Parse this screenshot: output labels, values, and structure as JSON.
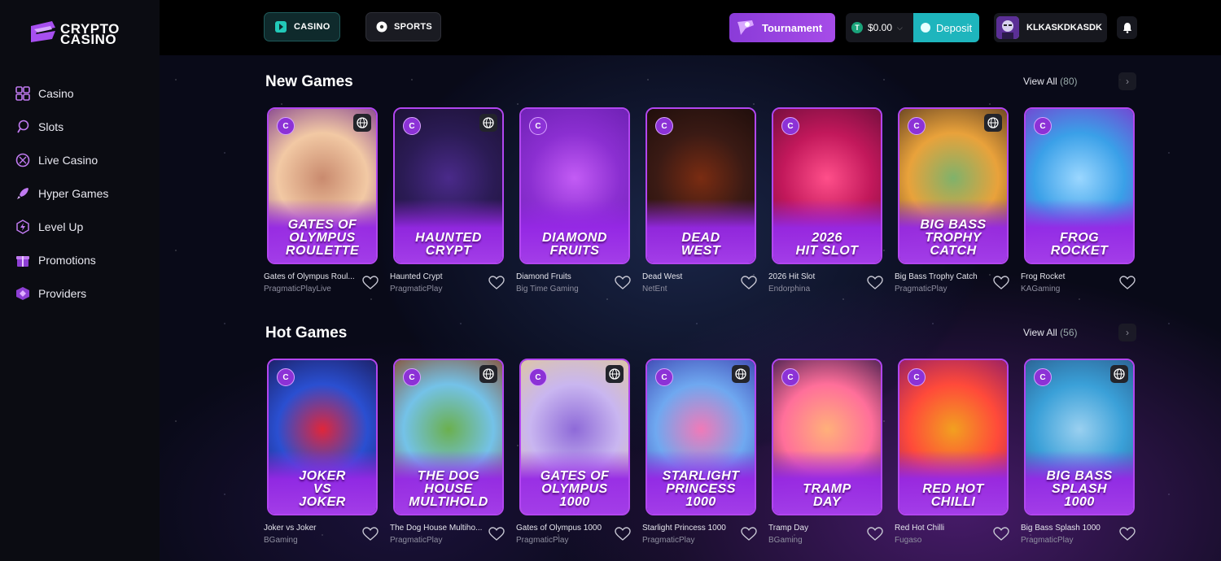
{
  "brand": {
    "line1": "CRYPTO",
    "line2": "CASINO"
  },
  "sidebar": {
    "items": [
      {
        "label": "Casino",
        "icon": "grid-icon"
      },
      {
        "label": "Slots",
        "icon": "slots-icon"
      },
      {
        "label": "Live Casino",
        "icon": "live-casino-icon"
      },
      {
        "label": "Hyper Games",
        "icon": "rocket-icon"
      },
      {
        "label": "Level Up",
        "icon": "level-up-icon"
      },
      {
        "label": "Promotions",
        "icon": "gift-icon"
      },
      {
        "label": "Providers",
        "icon": "providers-icon"
      }
    ]
  },
  "topbar": {
    "casino_label": "CASINO",
    "sports_label": "SPORTS",
    "tournament_label": "Tournament",
    "balance": "$0.00",
    "currency_symbol": "T",
    "deposit_label": "Deposit",
    "username": "KLKASKDKASDK"
  },
  "sections": [
    {
      "title": "New Games",
      "view_all": "View All",
      "count": "(80)",
      "games": [
        {
          "title_l1": "GATES OF",
          "title_l2": "OLYMPUS",
          "title_l3": "ROULETTE",
          "name": "Gates of Olympus Roul...",
          "provider": "PragmaticPlayLive",
          "live": true,
          "colors": [
            "#f2c9a4",
            "#c98a6e",
            "#7d3b8e"
          ]
        },
        {
          "title_l1": "",
          "title_l2": "HAUNTED",
          "title_l3": "CRYPT",
          "name": "Haunted Crypt",
          "provider": "PragmaticPlay",
          "live": true,
          "colors": [
            "#2b1b55",
            "#4a2a8a",
            "#1a1030"
          ]
        },
        {
          "title_l1": "",
          "title_l2": "DIAMOND",
          "title_l3": "FRUITS",
          "name": "Diamond Fruits",
          "provider": "Big Time Gaming",
          "live": false,
          "colors": [
            "#8b2fd1",
            "#c35cf5",
            "#6a1fb0"
          ]
        },
        {
          "title_l1": "",
          "title_l2": "DEAD",
          "title_l3": "WEST",
          "name": "Dead West",
          "provider": "NetEnt",
          "live": false,
          "colors": [
            "#3a1a14",
            "#7a2c12",
            "#1b0c0a"
          ]
        },
        {
          "title_l1": "",
          "title_l2": "2026",
          "title_l3": "HIT SLOT",
          "name": "2026 Hit Slot",
          "provider": "Endorphina",
          "live": false,
          "colors": [
            "#c2185b",
            "#ff4f8a",
            "#6a0d3a"
          ]
        },
        {
          "title_l1": "BIG BASS",
          "title_l2": "TROPHY",
          "title_l3": "CATCH",
          "name": "Big Bass Trophy Catch",
          "provider": "PragmaticPlay",
          "live": true,
          "colors": [
            "#e9a23b",
            "#7fb26b",
            "#5a3a20"
          ]
        },
        {
          "title_l1": "",
          "title_l2": "FROG",
          "title_l3": "ROCKET",
          "name": "Frog Rocket",
          "provider": "KAGaming",
          "live": false,
          "colors": [
            "#3aa0e8",
            "#9bd7ff",
            "#7b3bd0"
          ]
        }
      ]
    },
    {
      "title": "Hot Games",
      "view_all": "View All",
      "count": "(56)",
      "games": [
        {
          "title_l1": "JOKER",
          "title_l2": "VS",
          "title_l3": "JOKER",
          "name": "Joker vs Joker",
          "provider": "BGaming",
          "live": false,
          "colors": [
            "#2a4fd1",
            "#e0263a",
            "#1b1b5a"
          ]
        },
        {
          "title_l1": "THE DOG",
          "title_l2": "HOUSE",
          "title_l3": "MULTIHOLD",
          "name": "The Dog House Multiho...",
          "provider": "PragmaticPlay",
          "live": true,
          "colors": [
            "#74c2e8",
            "#6bb04e",
            "#8a4a2a"
          ]
        },
        {
          "title_l1": "GATES OF",
          "title_l2": "OLYMPUS",
          "title_l3": "1000",
          "name": "Gates of Olympus 1000",
          "provider": "PragmaticPlay",
          "live": true,
          "colors": [
            "#c9b6f0",
            "#8e6ad8",
            "#e0c89a"
          ]
        },
        {
          "title_l1": "STARLIGHT",
          "title_l2": "PRINCESS",
          "title_l3": "1000",
          "name": "Starlight Princess 1000",
          "provider": "PragmaticPlay",
          "live": true,
          "colors": [
            "#6fa8f0",
            "#f07ab8",
            "#3b3fae"
          ]
        },
        {
          "title_l1": "",
          "title_l2": "TRAMP",
          "title_l3": "DAY",
          "name": "Tramp Day",
          "provider": "BGaming",
          "live": false,
          "colors": [
            "#ff6f9a",
            "#ffb07a",
            "#3a1a4a"
          ]
        },
        {
          "title_l1": "",
          "title_l2": "RED HOT",
          "title_l3": "CHILLI",
          "name": "Red Hot Chilli",
          "provider": "Fugaso",
          "live": false,
          "colors": [
            "#ff4a3a",
            "#f2a020",
            "#8a1a6a"
          ]
        },
        {
          "title_l1": "BIG BASS",
          "title_l2": "SPLASH",
          "title_l3": "1000",
          "name": "Big Bass Splash 1000",
          "provider": "PragmaticPlay",
          "live": true,
          "colors": [
            "#3aa0d8",
            "#9ad0f0",
            "#2a5a8a"
          ]
        }
      ]
    }
  ],
  "colors": {
    "accent": "#b246f0",
    "deposit": "#1eb5bd",
    "tournament": "#9a44e0"
  }
}
